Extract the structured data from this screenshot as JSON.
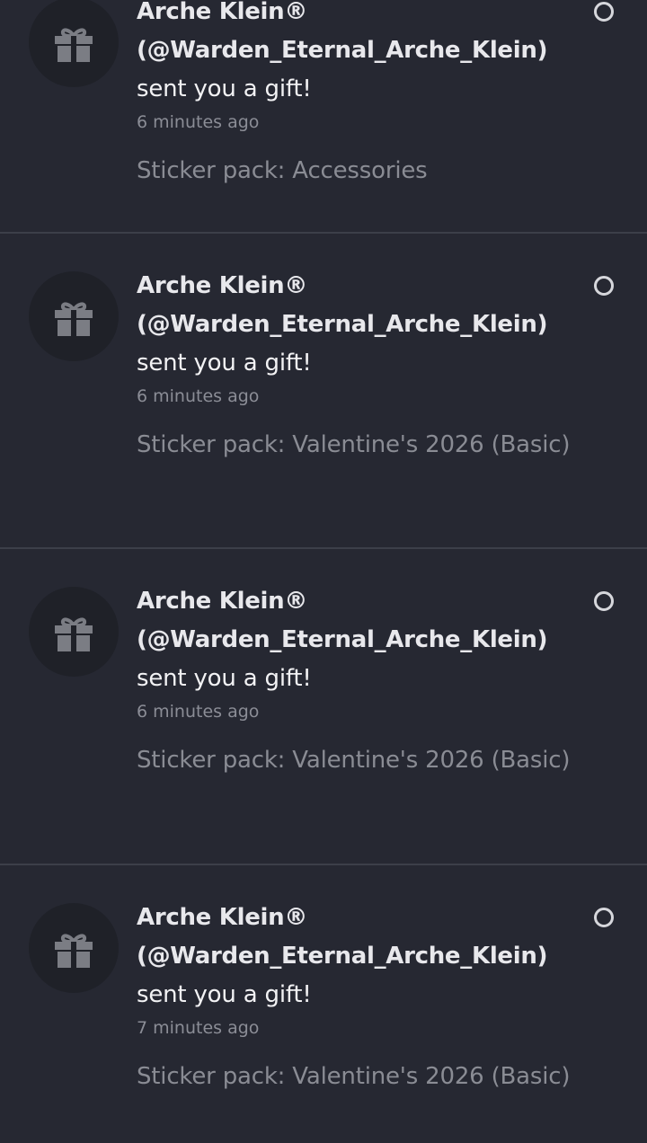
{
  "notifications": [
    {
      "name": "Arche Klein®",
      "handle": "(@Warden_Eternal_Arche_Klein)",
      "message": "sent you a gift!",
      "time": "6 minutes ago",
      "detail": "Sticker pack: Accessories",
      "icon": "gift-icon"
    },
    {
      "name": "Arche Klein®",
      "handle": "(@Warden_Eternal_Arche_Klein)",
      "message": "sent you a gift!",
      "time": "6 minutes ago",
      "detail": "Sticker pack: Valentine's 2026 (Basic)",
      "icon": "gift-icon"
    },
    {
      "name": "Arche Klein®",
      "handle": "(@Warden_Eternal_Arche_Klein)",
      "message": "sent you a gift!",
      "time": "6 minutes ago",
      "detail": "Sticker pack: Valentine's 2026 (Basic)",
      "icon": "gift-icon"
    },
    {
      "name": "Arche Klein®",
      "handle": "(@Warden_Eternal_Arche_Klein)",
      "message": "sent you a gift!",
      "time": "7 minutes ago",
      "detail": "Sticker pack: Valentine's 2026 (Basic)",
      "icon": "gift-icon"
    }
  ],
  "colors": {
    "background": "#262832",
    "avatar_bg": "#1f2128",
    "divider": "#3c3f49",
    "name_text": "#e8e8ec",
    "muted_text": "#8b8d96"
  }
}
